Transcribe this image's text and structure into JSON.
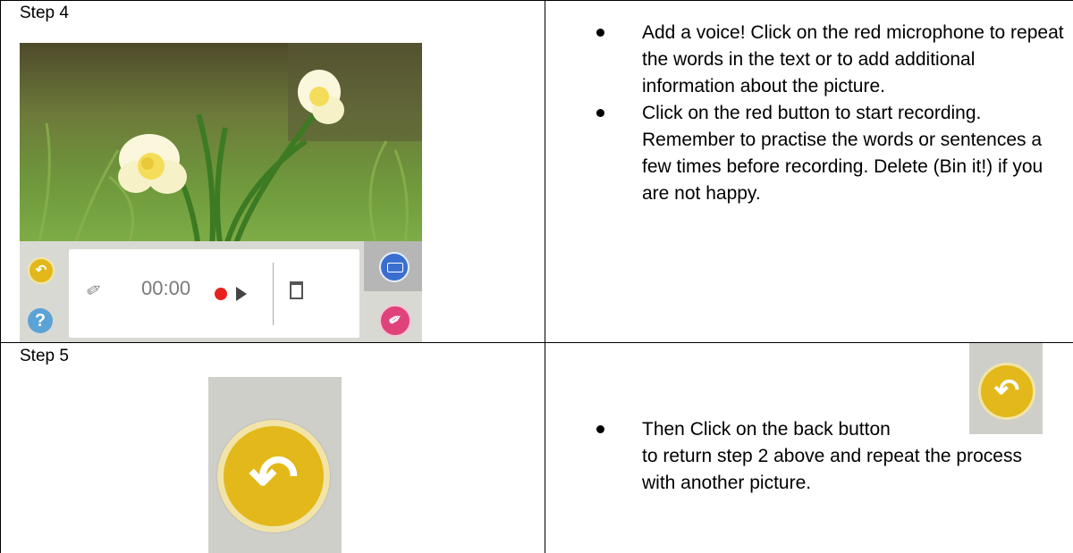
{
  "step4": {
    "label": "Step 4",
    "bullets": [
      "Add a voice! Click on the red microphone to repeat the words in the text or to add additional information about the picture.",
      "Click on the red button to start recording. Remember to practise the words or sentences a few times before recording. Delete (Bin it!) if you are not happy."
    ],
    "recorder": {
      "time": "00:00"
    }
  },
  "step5": {
    "label": "Step 5",
    "bullet_line1": "Then Click on the back button",
    "bullet_rest": "to return step 2 above and repeat the process with another picture."
  },
  "colors": {
    "back_button": "#e2b81a",
    "help_button": "#5ba3d6",
    "keyboard_button": "#3a6fd0",
    "mic_button": "#e0437a",
    "record_dot": "#e8231f"
  },
  "icons": [
    "back-icon",
    "help-icon",
    "keyboard-icon",
    "microphone-icon",
    "record-icon",
    "play-icon",
    "trash-icon"
  ]
}
